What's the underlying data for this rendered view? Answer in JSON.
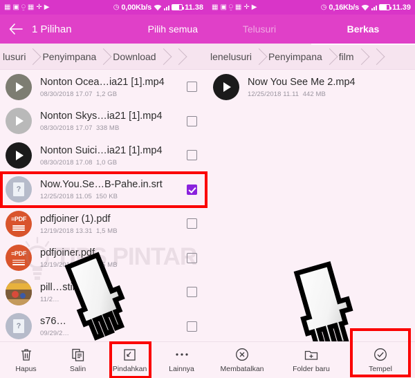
{
  "left": {
    "statusbar": {
      "icons": [
        "apps-icon",
        "sd-card-icon",
        "vibrate-icon",
        "apps-icon",
        "bluetooth-icon",
        "play-icon"
      ],
      "alarm_icon": "alarm-icon",
      "network_speed": "0,00Kb/s",
      "wifi_icon": "wifi-icon",
      "signal_icon": "signal-bars-icon",
      "battery_icon": "battery-icon",
      "clock": "11.38"
    },
    "appbar": {
      "back_icon": "back-arrow-icon",
      "title": "1 Pilihan",
      "action": "Pilih semua"
    },
    "breadcrumb": [
      "lusuri",
      "Penyimpana",
      "Download"
    ],
    "files": [
      {
        "name": "Nonton Ocea…ia21 [1].mp4",
        "date": "08/30/2018 17.07",
        "size": "1,2 GB",
        "icon": "video-thumbnail",
        "checked": false,
        "highlighted": false
      },
      {
        "name": "Nonton Skys…ia21 [1].mp4",
        "date": "08/30/2018 17.07",
        "size": "338 MB",
        "icon": "video-thumbnail",
        "checked": false,
        "highlighted": false
      },
      {
        "name": "Nonton Suici…ia21 [1].mp4",
        "date": "08/30/2018 17.08",
        "size": "1,0 GB",
        "icon": "video-thumbnail",
        "checked": false,
        "highlighted": false
      },
      {
        "name": "Now.You.Se…B-Pahe.in.srt",
        "date": "12/25/2018 11.05",
        "size": "150 KB",
        "icon": "unknown-file-icon",
        "checked": true,
        "highlighted": true
      },
      {
        "name": "pdfjoiner (1).pdf",
        "date": "12/19/2018 13.31",
        "size": "1,5 MB",
        "icon": "pdf-icon",
        "checked": false,
        "highlighted": false
      },
      {
        "name": "pdfjoiner.pdf",
        "date": "12/19/2018 13.29",
        "size": "1,5 MB",
        "icon": "pdf-icon",
        "checked": false,
        "highlighted": false
      },
      {
        "name": "pill…stiker.jpg",
        "date": "11/2…",
        "size": "",
        "icon": "image-thumbnail",
        "checked": false,
        "highlighted": false
      },
      {
        "name": "s76…",
        "date": "09/29/2…",
        "size": "",
        "icon": "unknown-file-icon",
        "checked": false,
        "highlighted": false
      }
    ],
    "bottombar": [
      {
        "label": "Hapus",
        "icon": "trash-icon",
        "highlighted": false
      },
      {
        "label": "Salin",
        "icon": "copy-icon",
        "highlighted": false
      },
      {
        "label": "Pindahkan",
        "icon": "move-icon",
        "highlighted": true
      },
      {
        "label": "Lainnya",
        "icon": "more-dots-icon",
        "highlighted": false
      }
    ],
    "watermark": "TIPS PINTAR"
  },
  "right": {
    "statusbar": {
      "icons": [
        "apps-icon",
        "sd-card-icon",
        "vibrate-icon",
        "apps-icon",
        "bluetooth-icon",
        "play-icon"
      ],
      "alarm_icon": "alarm-icon",
      "network_speed": "0,16Kb/s",
      "wifi_icon": "wifi-icon",
      "signal_icon": "signal-bars-icon",
      "battery_icon": "battery-icon",
      "clock": "11.39"
    },
    "appbar": {
      "tabs": [
        {
          "label": "Telusuri",
          "active": false
        },
        {
          "label": "Berkas",
          "active": true
        }
      ]
    },
    "breadcrumb": [
      "lenelusuri",
      "Penyimpana",
      "film"
    ],
    "files": [
      {
        "name": "Now You See Me 2.mp4",
        "date": "12/25/2018 11.11",
        "size": "442 MB",
        "icon": "video-thumbnail",
        "checked": false,
        "highlighted": false
      }
    ],
    "bottombar": [
      {
        "label": "Membatalkan",
        "icon": "cancel-circle-icon",
        "highlighted": false
      },
      {
        "label": "Folder baru",
        "icon": "new-folder-icon",
        "highlighted": false
      },
      {
        "label": "Tempel",
        "icon": "check-circle-icon",
        "highlighted": true
      }
    ]
  },
  "colors": {
    "status_bar": "#d935c8",
    "app_bar": "#e040c8",
    "background": "#fcf0f7",
    "highlight": "#fb0000",
    "checkbox_checked": "#8a22dd"
  }
}
